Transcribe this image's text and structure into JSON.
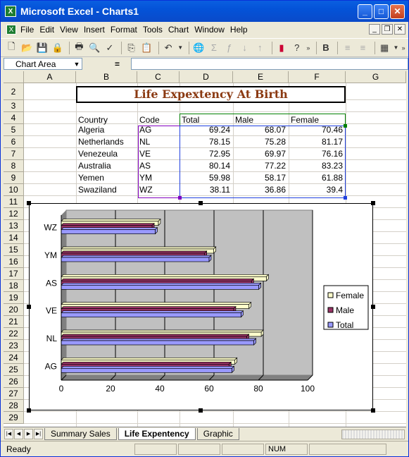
{
  "window": {
    "title": "Microsoft Excel - Charts1",
    "app_icon": "excel-icon"
  },
  "menu": [
    "File",
    "Edit",
    "View",
    "Insert",
    "Format",
    "Tools",
    "Chart",
    "Window",
    "Help"
  ],
  "namebox": {
    "value": "Chart Area"
  },
  "formula": {
    "eq": "="
  },
  "columns": [
    "A",
    "B",
    "C",
    "D",
    "E",
    "F",
    "G"
  ],
  "rows": [
    "2",
    "3",
    "4",
    "5",
    "6",
    "7",
    "8",
    "9",
    "10",
    "11",
    "12",
    "13",
    "14",
    "15",
    "16",
    "17",
    "18",
    "19",
    "20",
    "21",
    "22",
    "23",
    "24",
    "25",
    "26",
    "27",
    "28",
    "29"
  ],
  "sheet": {
    "title": "Life Expextency At Birth",
    "headers": [
      "Country",
      "Code",
      "Total",
      "Male",
      "Female"
    ],
    "data": [
      [
        "Algeria",
        "AG",
        "69.24",
        "68.07",
        "70.46"
      ],
      [
        "Netherlands",
        "NL",
        "78.15",
        "75.28",
        "81.17"
      ],
      [
        "Venezeula",
        "VE",
        "72.95",
        "69.97",
        "76.16"
      ],
      [
        "Australia",
        "AS",
        "80.14",
        "77.22",
        "83.23"
      ],
      [
        "Yemen",
        "YM",
        "59.98",
        "58.17",
        "61.88"
      ],
      [
        "Swaziland",
        "WZ",
        "38.11",
        "36.86",
        "39.4"
      ]
    ]
  },
  "chart_data": {
    "type": "bar",
    "orientation": "horizontal",
    "categories": [
      "AG",
      "NL",
      "VE",
      "AS",
      "YM",
      "WZ"
    ],
    "series": [
      {
        "name": "Female",
        "values": [
          70.46,
          81.17,
          76.16,
          83.23,
          61.88,
          39.4
        ],
        "color": "#ffffcc"
      },
      {
        "name": "Male",
        "values": [
          68.07,
          75.28,
          69.97,
          77.22,
          58.17,
          36.86
        ],
        "color": "#993366"
      },
      {
        "name": "Total",
        "values": [
          69.24,
          78.15,
          72.95,
          80.14,
          59.98,
          38.11
        ],
        "color": "#9999ff"
      }
    ],
    "xlim": [
      0,
      100
    ],
    "ticks": [
      "0",
      "20",
      "40",
      "60",
      "80",
      "100"
    ],
    "legend": "right",
    "grid": true
  },
  "tabs": [
    "Summary Sales",
    "Life Expentency",
    "Graphic"
  ],
  "active_tab": "Life Expentency",
  "status": {
    "text": "Ready",
    "num": "NUM"
  }
}
